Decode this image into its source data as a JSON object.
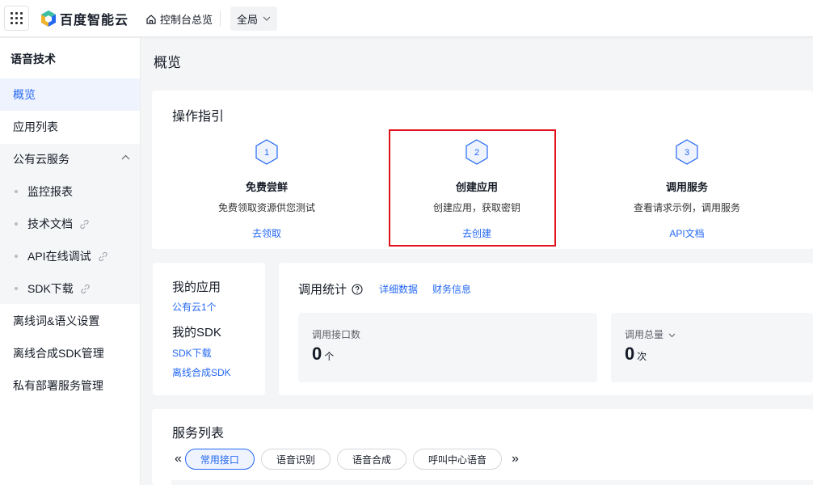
{
  "header": {
    "brand": "百度智能云",
    "console_label": "控制台总览",
    "scope_label": "全局"
  },
  "sidebar": {
    "title": "语音技术",
    "items": [
      {
        "label": "概览"
      },
      {
        "label": "应用列表"
      },
      {
        "label": "公有云服务"
      },
      {
        "label": "监控报表"
      },
      {
        "label": "技术文档"
      },
      {
        "label": "API在线调试"
      },
      {
        "label": "SDK下载"
      },
      {
        "label": "离线词&语义设置"
      },
      {
        "label": "离线合成SDK管理"
      },
      {
        "label": "私有部署服务管理"
      }
    ]
  },
  "page_title": "概览",
  "guide": {
    "title": "操作指引",
    "steps": [
      {
        "num": "1",
        "title": "免费尝鲜",
        "desc": "免费领取资源供您测试",
        "link": "去领取"
      },
      {
        "num": "2",
        "title": "创建应用",
        "desc": "创建应用，获取密钥",
        "link": "去创建"
      },
      {
        "num": "3",
        "title": "调用服务",
        "desc": "查看请求示例，调用服务",
        "link": "API文档"
      }
    ]
  },
  "my_app": {
    "apps_label": "我的应用",
    "apps_link": "公有云1个",
    "sdk_label": "我的SDK",
    "sdk_link1": "SDK下载",
    "sdk_link2": "离线合成SDK"
  },
  "stats": {
    "title": "调用统计",
    "link1": "详细数据",
    "link2": "财务信息",
    "metrics": [
      {
        "label": "调用接口数",
        "value": "0",
        "unit": "个"
      },
      {
        "label": "调用总量",
        "value": "0",
        "unit": "次"
      }
    ]
  },
  "services": {
    "title": "服务列表",
    "tabs": [
      "常用接口",
      "语音识别",
      "语音合成",
      "呼叫中心语音"
    ],
    "active_tab": "常用接口"
  },
  "colors": {
    "accent": "#2468f2",
    "highlight": "#e0121c"
  }
}
